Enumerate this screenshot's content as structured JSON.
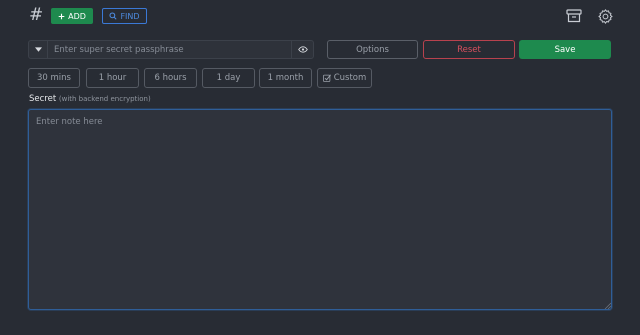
{
  "header": {
    "logo": "#",
    "add_label": "ADD",
    "add_icon": "plus-icon",
    "find_label": "FIND",
    "find_icon": "search-icon",
    "archive_icon": "archive-icon",
    "settings_icon": "gear-icon"
  },
  "passphrase": {
    "placeholder": "Enter super secret passphrase",
    "value": "",
    "dropdown_icon": "caret-down-icon",
    "toggle_icon": "eye-icon"
  },
  "actions": {
    "options_label": "Options",
    "reset_label": "Reset",
    "save_label": "Save"
  },
  "durations": [
    {
      "label": "30 mins"
    },
    {
      "label": "1 hour"
    },
    {
      "label": "6 hours"
    },
    {
      "label": "1 day"
    },
    {
      "label": "1 month"
    },
    {
      "label": "Custom",
      "checked": true
    }
  ],
  "secret": {
    "label": "Secret",
    "sublabel": "(with backend encryption)",
    "placeholder": "Enter note here",
    "value": ""
  },
  "colors": {
    "background": "#282c34",
    "accent_green": "#1e8a4e",
    "accent_blue": "#3b79d6",
    "accent_red": "#d9505e"
  }
}
